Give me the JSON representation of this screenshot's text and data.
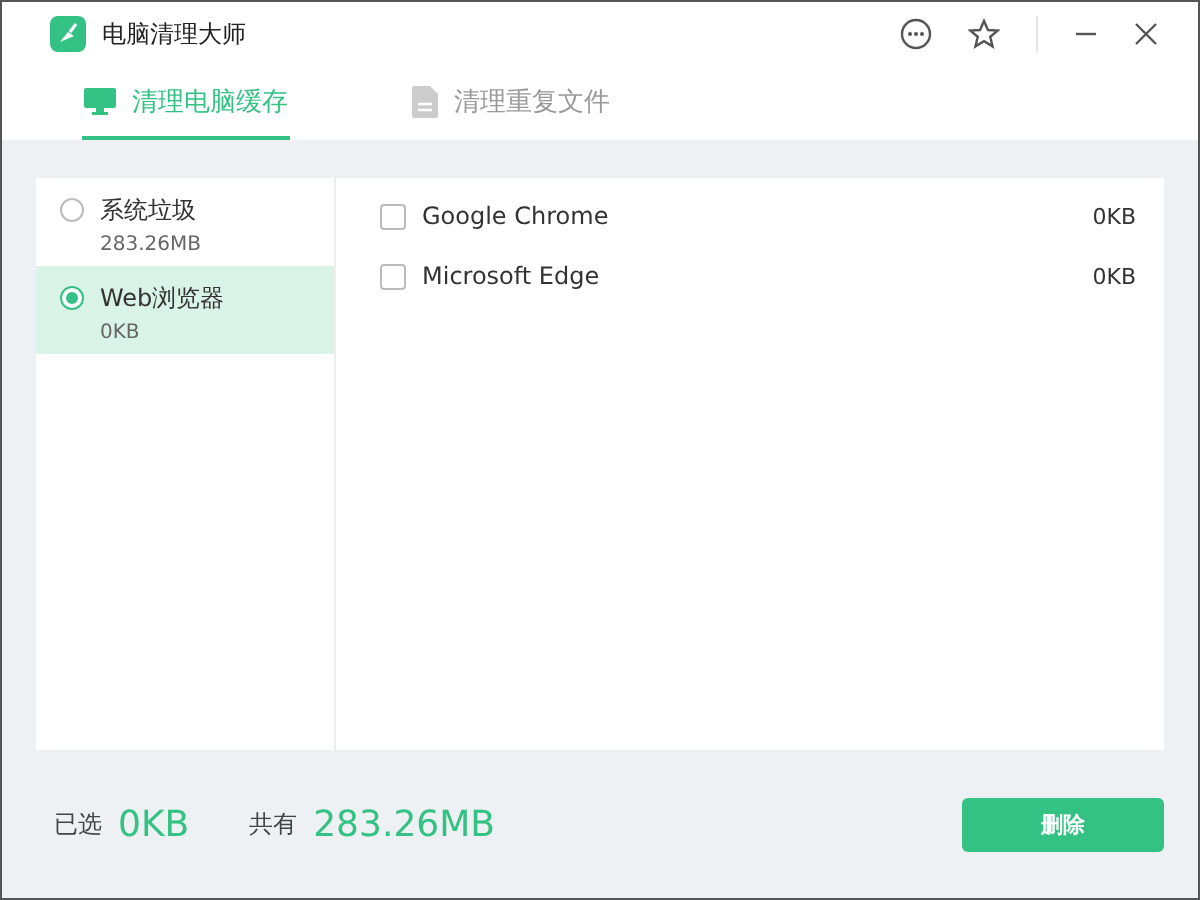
{
  "window": {
    "title": "电脑清理大师"
  },
  "tabs": [
    {
      "label": "清理电脑缓存",
      "selected": true,
      "kind": "monitor"
    },
    {
      "label": "清理重复文件",
      "selected": false,
      "kind": "file"
    }
  ],
  "categories": [
    {
      "name": "系统垃圾",
      "size": "283.26MB",
      "selected": false
    },
    {
      "name": "Web浏览器",
      "size": "0KB",
      "selected": true
    }
  ],
  "items": [
    {
      "name": "Google Chrome",
      "size": "0KB",
      "checked": false
    },
    {
      "name": "Microsoft Edge",
      "size": "0KB",
      "checked": false
    }
  ],
  "footer": {
    "selected_label": "已选",
    "selected_value": "0KB",
    "total_label": "共有",
    "total_value": "283.26MB",
    "button": "删除"
  }
}
